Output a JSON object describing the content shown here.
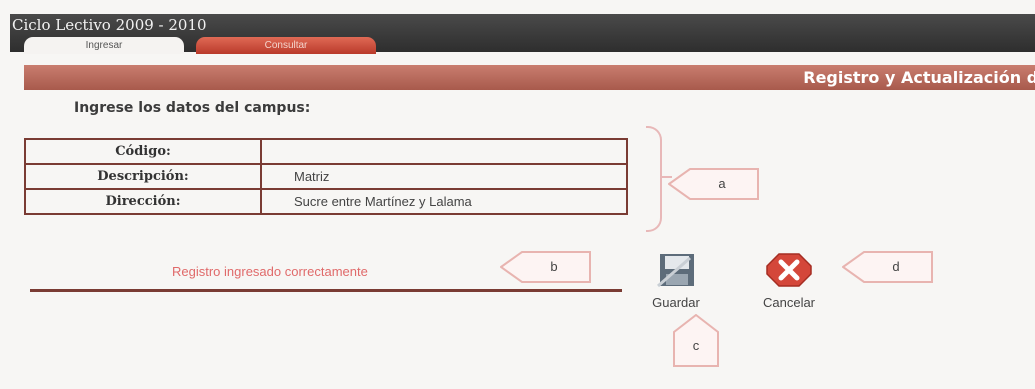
{
  "header": {
    "title": "Ciclo Lectivo 2009 - 2010",
    "tabs": [
      {
        "label": "Ingresar",
        "active": true
      },
      {
        "label": "Consultar",
        "active": false
      }
    ]
  },
  "section": {
    "title": "Registro y Actualización de",
    "instructions": "Ingrese los datos del campus:"
  },
  "form": {
    "fields": [
      {
        "label": "Código:",
        "value": ""
      },
      {
        "label": "Descripción:",
        "value": "Matriz"
      },
      {
        "label": "Dirección:",
        "value": "Sucre entre Martínez y Lalama"
      }
    ]
  },
  "status": {
    "message": "Registro ingresado correctamente"
  },
  "actions": {
    "save_label": "Guardar",
    "cancel_label": "Cancelar"
  },
  "callouts": {
    "a": "a",
    "b": "b",
    "c": "c",
    "d": "d"
  },
  "colors": {
    "header_bg": "#2e2e2e",
    "accent": "#a85a4c",
    "status_text": "#e06a6a"
  }
}
